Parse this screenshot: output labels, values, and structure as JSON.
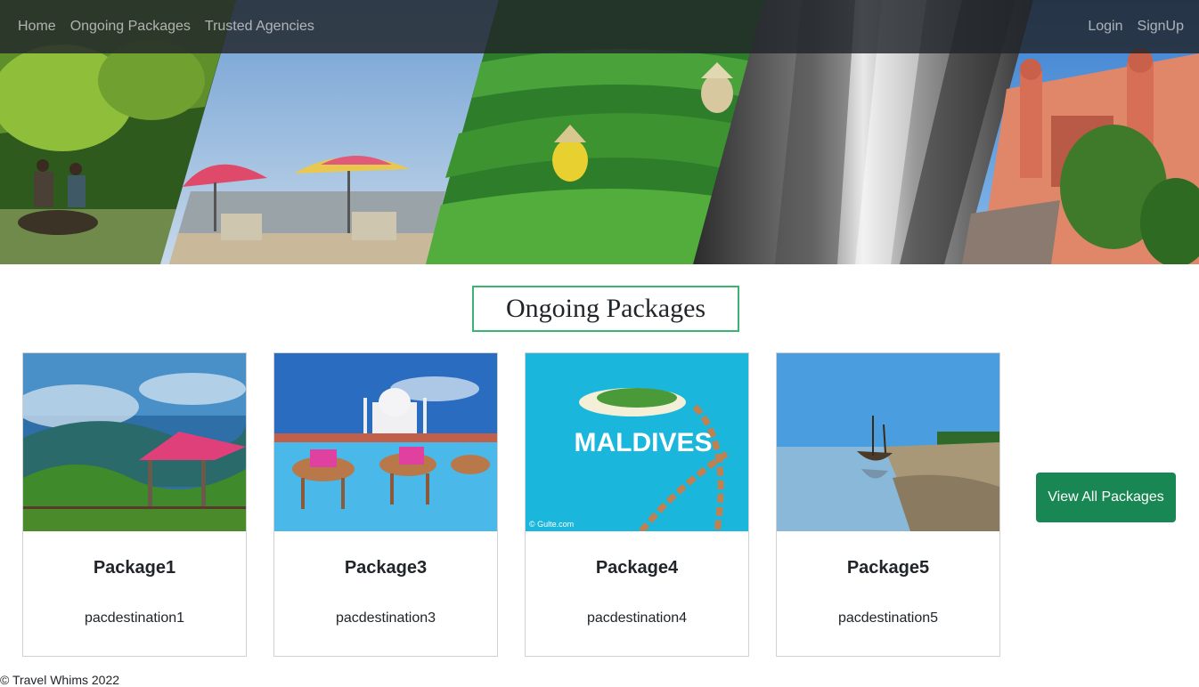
{
  "nav": {
    "left": [
      "Home",
      "Ongoing Packages",
      "Trusted Agencies"
    ],
    "right": [
      "Login",
      "SignUp"
    ]
  },
  "hero": {
    "panels": [
      "forest-boat-image",
      "beach-umbrellas-image",
      "tea-garden-image",
      "waterfall-image",
      "palace-image"
    ]
  },
  "section": {
    "title": "Ongoing Packages"
  },
  "packages": [
    {
      "name": "Package1",
      "destination": "pacdestination1",
      "image": "hill-resort-gazebo-image"
    },
    {
      "name": "Package3",
      "destination": "pacdestination3",
      "image": "taj-mahal-camels-image"
    },
    {
      "name": "Package4",
      "destination": "pacdestination4",
      "image": "maldives-island-image",
      "image_text": "MALDIVES",
      "image_credit": "© Gulte.com"
    },
    {
      "name": "Package5",
      "destination": "pacdestination5",
      "image": "beach-boat-image"
    }
  ],
  "view_all_label": "View All Packages",
  "footer": {
    "text": "© Travel Whims 2022"
  },
  "colors": {
    "accent": "#198754",
    "title_border": "#3cb371",
    "navbar": "#212529"
  }
}
